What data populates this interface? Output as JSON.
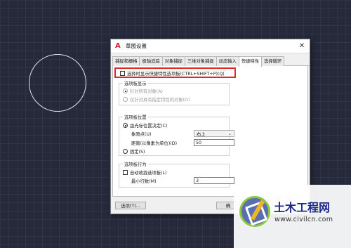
{
  "dialog": {
    "title": "草图设置",
    "close_glyph": "✕",
    "tabs": [
      "捕捉和栅格",
      "极轴追踪",
      "对象捕捉",
      "三维对象捕捉",
      "动态输入",
      "快捷特性",
      "选择循环"
    ],
    "active_tab_index": 5
  },
  "quick_props": {
    "show_on_select": "选择时显示快捷特性选项板(CTRL+SHIFT+P)(Q)",
    "display_group": {
      "label": "选项板显示",
      "all_objects": "针对所有对象(A)",
      "custom_only": "仅针对具有指定特性的对象(O)"
    },
    "location_group": {
      "label": "选项板位置",
      "cursor_dependent": "由光标位置决定(C)",
      "quadrant_label": "象限点(U)",
      "quadrant_value": "右上",
      "distance_label": "距离(以像素为单位)(D)",
      "distance_value": "50",
      "static": "固定(S)"
    },
    "behavior_group": {
      "label": "选项板行为",
      "auto_collapse": "自动收拢选项板(L)",
      "min_rows_label": "最小行数(M)",
      "min_rows_value": "3"
    }
  },
  "footer": {
    "options_button": "选项(T)...",
    "ok_button": "确"
  },
  "watermark": {
    "brand": "土木工程网",
    "url": "www.civilcn.com"
  }
}
